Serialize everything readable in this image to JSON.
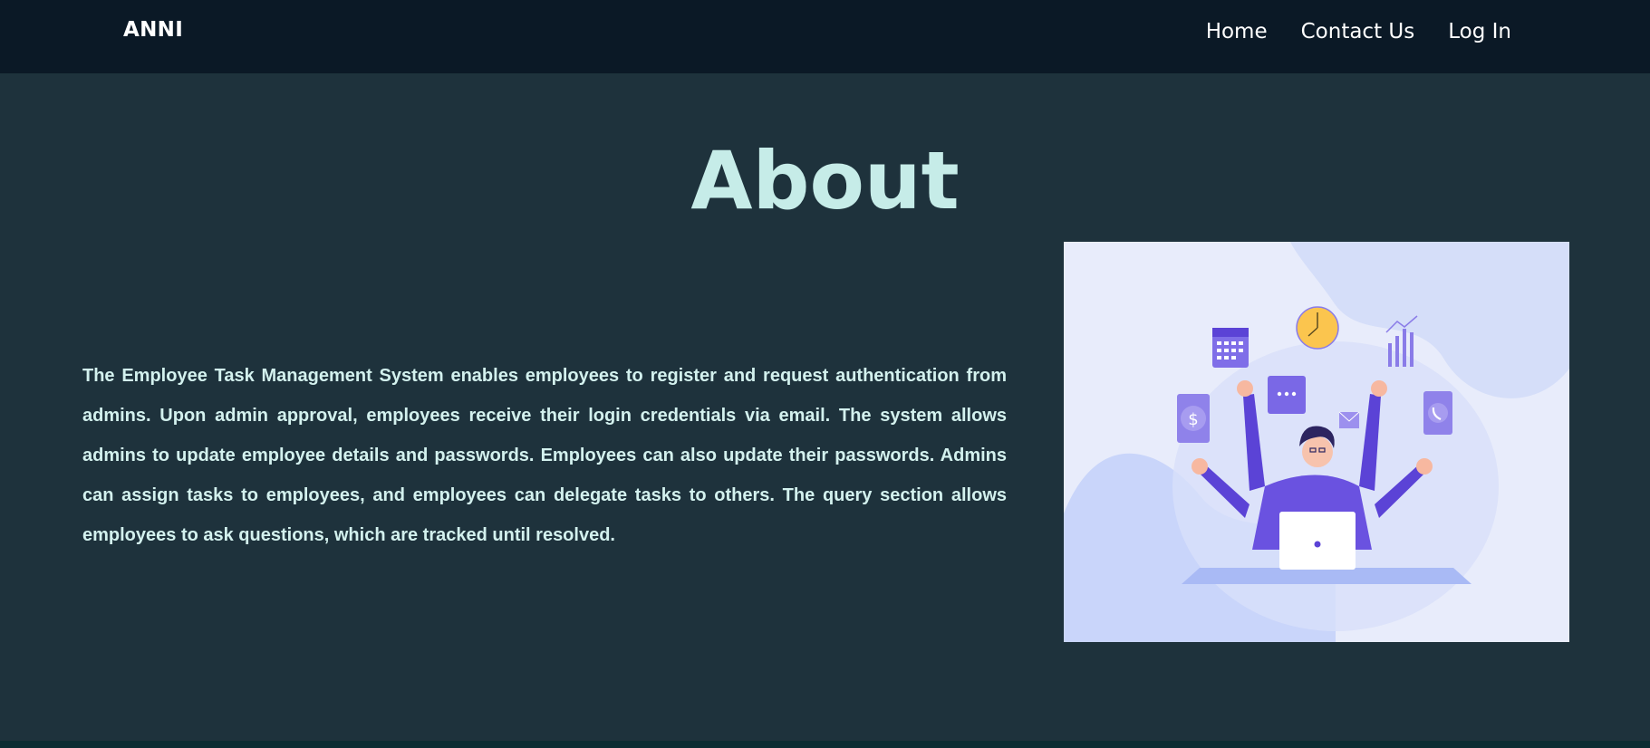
{
  "navbar": {
    "brand": "ANNI",
    "links": [
      {
        "label": "Home"
      },
      {
        "label": "Contact Us"
      },
      {
        "label": "Log In"
      }
    ]
  },
  "main": {
    "title": "About",
    "description": "The Employee Task Management System enables employees to register and request authentication from admins. Upon admin approval, employees receive their login credentials via email. The system allows admins to update employee details and passwords. Employees can also update their passwords. Admins can assign tasks to employees, and employees can delegate tasks to others. The query section allows employees to ask questions, which are tracked until resolved.",
    "illustration": {
      "subject": "multitasking-employee-illustration",
      "icons": [
        "calendar-icon",
        "clock-icon",
        "bar-chart-icon",
        "dollar-icon",
        "chat-bubble-icon",
        "envelope-icon",
        "phone-icon",
        "laptop-icon"
      ]
    }
  },
  "colors": {
    "navbar_bg": "#0b1926",
    "page_bg": "#1e323c",
    "title": "#c6ece8",
    "text": "#d3f1ee",
    "illustration_bg": "#e8ecfb",
    "accent_purple": "#5b43d6",
    "accent_yellow": "#fbc54e"
  }
}
